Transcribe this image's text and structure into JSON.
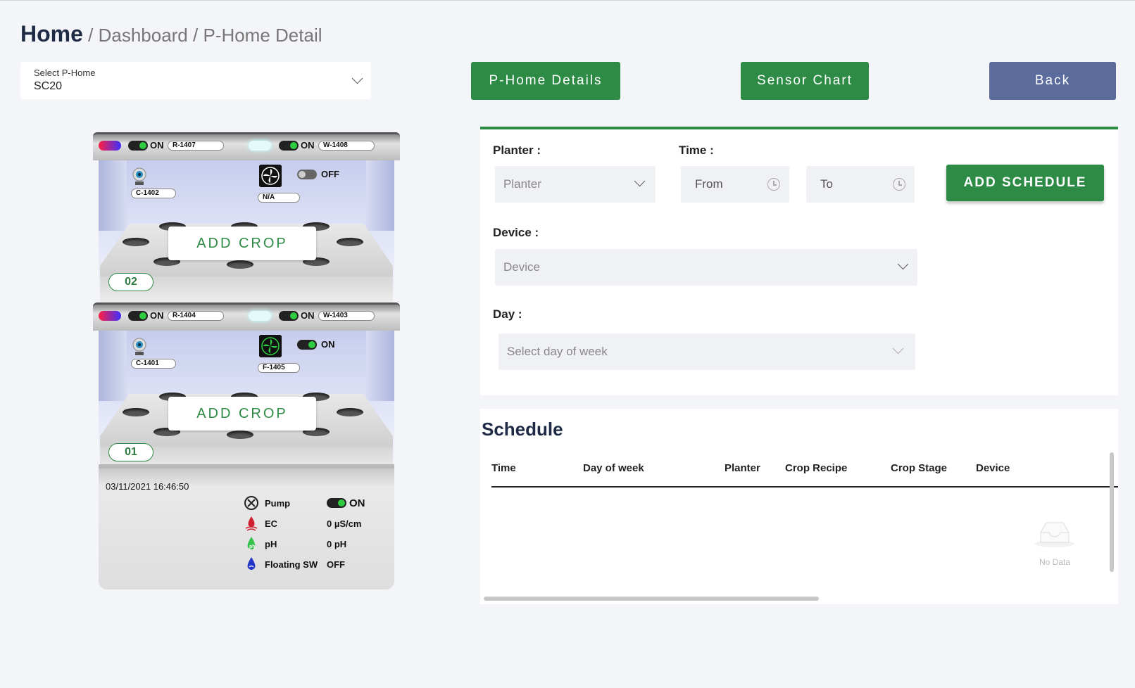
{
  "breadcrumb": {
    "home": "Home",
    "rest": " / Dashboard / P-Home Detail"
  },
  "select_phome": {
    "label": "Select P-Home",
    "value": "SC20"
  },
  "buttons": {
    "details": "P-Home Details",
    "chart": "Sensor Chart",
    "back": "Back"
  },
  "shelves": [
    {
      "number": "02",
      "red_led": {
        "state": "ON",
        "id": "R-1407"
      },
      "white_led": {
        "state": "ON",
        "id": "W-1408"
      },
      "camera_id": "C-1402",
      "fan": {
        "state": "OFF",
        "id": "N/A"
      },
      "add_crop": "ADD CROP"
    },
    {
      "number": "01",
      "red_led": {
        "state": "ON",
        "id": "R-1404"
      },
      "white_led": {
        "state": "ON",
        "id": "W-1403"
      },
      "camera_id": "C-1401",
      "fan": {
        "state": "ON",
        "id": "F-1405"
      },
      "add_crop": "ADD CROP"
    }
  ],
  "tank": {
    "timestamp": "03/11/2021 16:46:50",
    "pump": {
      "label": "Pump",
      "value": "ON"
    },
    "ec": {
      "label": "EC",
      "value": "0 µS/cm"
    },
    "ph": {
      "label": "pH",
      "value": "0 pH"
    },
    "floating": {
      "label": "Floating SW",
      "value": "OFF"
    }
  },
  "form": {
    "planter_label": "Planter :",
    "planter_placeholder": "Planter",
    "time_label": "Time :",
    "from_placeholder": "From",
    "to_placeholder": "To",
    "add_schedule": "ADD SCHEDULE",
    "device_label": "Device :",
    "device_placeholder": "Device",
    "day_label": "Day :",
    "day_placeholder": "Select day of week"
  },
  "schedule": {
    "title": "Schedule",
    "columns": [
      "Time",
      "Day of week",
      "Planter",
      "Crop Recipe",
      "Crop Stage",
      "Device"
    ],
    "empty_text": "No Data"
  },
  "colors": {
    "accent_green": "#2e8b45",
    "back_blue": "#5a6b9c"
  }
}
